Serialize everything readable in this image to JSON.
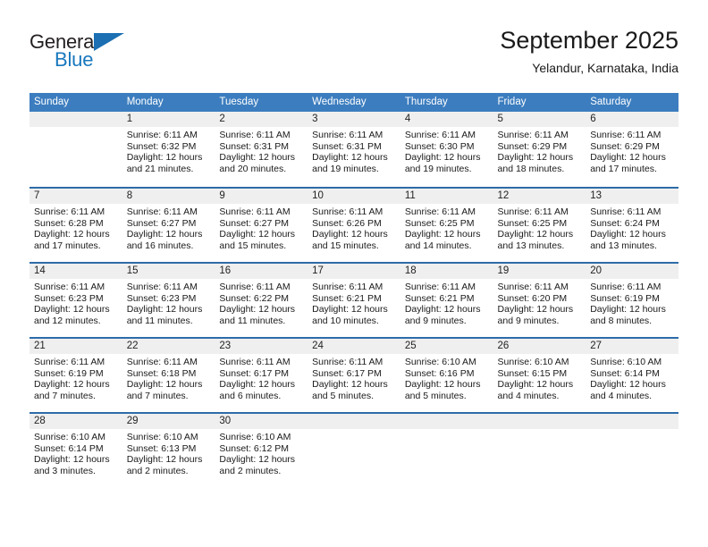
{
  "brand": {
    "word_one": "General",
    "word_two": "Blue",
    "triangle_icon": "triangle-icon",
    "accent_color": "#1b6fb2"
  },
  "header": {
    "title": "September 2025",
    "subtitle": "Yelandur, Karnataka, India"
  },
  "colors": {
    "header_band": "#3C7DBF",
    "row_divider": "#2E6CA8",
    "daynum_band": "#EFEFEF"
  },
  "weekday_headers": [
    "Sunday",
    "Monday",
    "Tuesday",
    "Wednesday",
    "Thursday",
    "Friday",
    "Saturday"
  ],
  "weeks": [
    [
      {
        "day": "",
        "sunrise": "",
        "sunset": "",
        "daylight_1": "",
        "daylight_2": "",
        "empty": true
      },
      {
        "day": "1",
        "sunrise": "Sunrise: 6:11 AM",
        "sunset": "Sunset: 6:32 PM",
        "daylight_1": "Daylight: 12 hours",
        "daylight_2": "and 21 minutes."
      },
      {
        "day": "2",
        "sunrise": "Sunrise: 6:11 AM",
        "sunset": "Sunset: 6:31 PM",
        "daylight_1": "Daylight: 12 hours",
        "daylight_2": "and 20 minutes."
      },
      {
        "day": "3",
        "sunrise": "Sunrise: 6:11 AM",
        "sunset": "Sunset: 6:31 PM",
        "daylight_1": "Daylight: 12 hours",
        "daylight_2": "and 19 minutes."
      },
      {
        "day": "4",
        "sunrise": "Sunrise: 6:11 AM",
        "sunset": "Sunset: 6:30 PM",
        "daylight_1": "Daylight: 12 hours",
        "daylight_2": "and 19 minutes."
      },
      {
        "day": "5",
        "sunrise": "Sunrise: 6:11 AM",
        "sunset": "Sunset: 6:29 PM",
        "daylight_1": "Daylight: 12 hours",
        "daylight_2": "and 18 minutes."
      },
      {
        "day": "6",
        "sunrise": "Sunrise: 6:11 AM",
        "sunset": "Sunset: 6:29 PM",
        "daylight_1": "Daylight: 12 hours",
        "daylight_2": "and 17 minutes."
      }
    ],
    [
      {
        "day": "7",
        "sunrise": "Sunrise: 6:11 AM",
        "sunset": "Sunset: 6:28 PM",
        "daylight_1": "Daylight: 12 hours",
        "daylight_2": "and 17 minutes."
      },
      {
        "day": "8",
        "sunrise": "Sunrise: 6:11 AM",
        "sunset": "Sunset: 6:27 PM",
        "daylight_1": "Daylight: 12 hours",
        "daylight_2": "and 16 minutes."
      },
      {
        "day": "9",
        "sunrise": "Sunrise: 6:11 AM",
        "sunset": "Sunset: 6:27 PM",
        "daylight_1": "Daylight: 12 hours",
        "daylight_2": "and 15 minutes."
      },
      {
        "day": "10",
        "sunrise": "Sunrise: 6:11 AM",
        "sunset": "Sunset: 6:26 PM",
        "daylight_1": "Daylight: 12 hours",
        "daylight_2": "and 15 minutes."
      },
      {
        "day": "11",
        "sunrise": "Sunrise: 6:11 AM",
        "sunset": "Sunset: 6:25 PM",
        "daylight_1": "Daylight: 12 hours",
        "daylight_2": "and 14 minutes."
      },
      {
        "day": "12",
        "sunrise": "Sunrise: 6:11 AM",
        "sunset": "Sunset: 6:25 PM",
        "daylight_1": "Daylight: 12 hours",
        "daylight_2": "and 13 minutes."
      },
      {
        "day": "13",
        "sunrise": "Sunrise: 6:11 AM",
        "sunset": "Sunset: 6:24 PM",
        "daylight_1": "Daylight: 12 hours",
        "daylight_2": "and 13 minutes."
      }
    ],
    [
      {
        "day": "14",
        "sunrise": "Sunrise: 6:11 AM",
        "sunset": "Sunset: 6:23 PM",
        "daylight_1": "Daylight: 12 hours",
        "daylight_2": "and 12 minutes."
      },
      {
        "day": "15",
        "sunrise": "Sunrise: 6:11 AM",
        "sunset": "Sunset: 6:23 PM",
        "daylight_1": "Daylight: 12 hours",
        "daylight_2": "and 11 minutes."
      },
      {
        "day": "16",
        "sunrise": "Sunrise: 6:11 AM",
        "sunset": "Sunset: 6:22 PM",
        "daylight_1": "Daylight: 12 hours",
        "daylight_2": "and 11 minutes."
      },
      {
        "day": "17",
        "sunrise": "Sunrise: 6:11 AM",
        "sunset": "Sunset: 6:21 PM",
        "daylight_1": "Daylight: 12 hours",
        "daylight_2": "and 10 minutes."
      },
      {
        "day": "18",
        "sunrise": "Sunrise: 6:11 AM",
        "sunset": "Sunset: 6:21 PM",
        "daylight_1": "Daylight: 12 hours",
        "daylight_2": "and 9 minutes."
      },
      {
        "day": "19",
        "sunrise": "Sunrise: 6:11 AM",
        "sunset": "Sunset: 6:20 PM",
        "daylight_1": "Daylight: 12 hours",
        "daylight_2": "and 9 minutes."
      },
      {
        "day": "20",
        "sunrise": "Sunrise: 6:11 AM",
        "sunset": "Sunset: 6:19 PM",
        "daylight_1": "Daylight: 12 hours",
        "daylight_2": "and 8 minutes."
      }
    ],
    [
      {
        "day": "21",
        "sunrise": "Sunrise: 6:11 AM",
        "sunset": "Sunset: 6:19 PM",
        "daylight_1": "Daylight: 12 hours",
        "daylight_2": "and 7 minutes."
      },
      {
        "day": "22",
        "sunrise": "Sunrise: 6:11 AM",
        "sunset": "Sunset: 6:18 PM",
        "daylight_1": "Daylight: 12 hours",
        "daylight_2": "and 7 minutes."
      },
      {
        "day": "23",
        "sunrise": "Sunrise: 6:11 AM",
        "sunset": "Sunset: 6:17 PM",
        "daylight_1": "Daylight: 12 hours",
        "daylight_2": "and 6 minutes."
      },
      {
        "day": "24",
        "sunrise": "Sunrise: 6:11 AM",
        "sunset": "Sunset: 6:17 PM",
        "daylight_1": "Daylight: 12 hours",
        "daylight_2": "and 5 minutes."
      },
      {
        "day": "25",
        "sunrise": "Sunrise: 6:10 AM",
        "sunset": "Sunset: 6:16 PM",
        "daylight_1": "Daylight: 12 hours",
        "daylight_2": "and 5 minutes."
      },
      {
        "day": "26",
        "sunrise": "Sunrise: 6:10 AM",
        "sunset": "Sunset: 6:15 PM",
        "daylight_1": "Daylight: 12 hours",
        "daylight_2": "and 4 minutes."
      },
      {
        "day": "27",
        "sunrise": "Sunrise: 6:10 AM",
        "sunset": "Sunset: 6:14 PM",
        "daylight_1": "Daylight: 12 hours",
        "daylight_2": "and 4 minutes."
      }
    ],
    [
      {
        "day": "28",
        "sunrise": "Sunrise: 6:10 AM",
        "sunset": "Sunset: 6:14 PM",
        "daylight_1": "Daylight: 12 hours",
        "daylight_2": "and 3 minutes."
      },
      {
        "day": "29",
        "sunrise": "Sunrise: 6:10 AM",
        "sunset": "Sunset: 6:13 PM",
        "daylight_1": "Daylight: 12 hours",
        "daylight_2": "and 2 minutes."
      },
      {
        "day": "30",
        "sunrise": "Sunrise: 6:10 AM",
        "sunset": "Sunset: 6:12 PM",
        "daylight_1": "Daylight: 12 hours",
        "daylight_2": "and 2 minutes."
      },
      {
        "day": "",
        "sunrise": "",
        "sunset": "",
        "daylight_1": "",
        "daylight_2": "",
        "empty": true
      },
      {
        "day": "",
        "sunrise": "",
        "sunset": "",
        "daylight_1": "",
        "daylight_2": "",
        "empty": true
      },
      {
        "day": "",
        "sunrise": "",
        "sunset": "",
        "daylight_1": "",
        "daylight_2": "",
        "empty": true
      },
      {
        "day": "",
        "sunrise": "",
        "sunset": "",
        "daylight_1": "",
        "daylight_2": "",
        "empty": true
      }
    ]
  ]
}
